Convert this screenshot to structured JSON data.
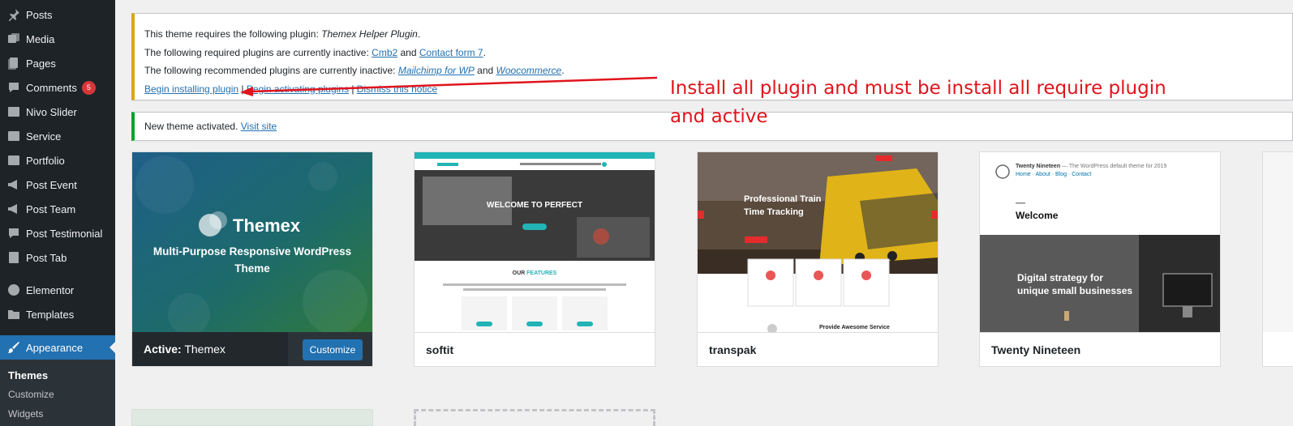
{
  "sidebar": {
    "items": [
      {
        "label": "Posts",
        "icon": "pin-icon"
      },
      {
        "label": "Media",
        "icon": "media-icon"
      },
      {
        "label": "Pages",
        "icon": "pages-icon"
      },
      {
        "label": "Comments",
        "icon": "comments-icon",
        "badge": "5"
      },
      {
        "label": "Nivo Slider",
        "icon": "slider-icon"
      },
      {
        "label": "Service",
        "icon": "service-icon"
      },
      {
        "label": "Portfolio",
        "icon": "portfolio-icon"
      },
      {
        "label": "Post Event",
        "icon": "megaphone-icon"
      },
      {
        "label": "Post Team",
        "icon": "megaphone-icon"
      },
      {
        "label": "Post Testimonial",
        "icon": "testimonial-icon"
      },
      {
        "label": "Post Tab",
        "icon": "tab-icon"
      },
      {
        "label": "Elementor",
        "icon": "elementor-icon"
      },
      {
        "label": "Templates",
        "icon": "folder-icon"
      },
      {
        "label": "Appearance",
        "icon": "brush-icon",
        "current": true
      }
    ],
    "submenu": [
      {
        "label": "Themes",
        "current": true
      },
      {
        "label": "Customize"
      },
      {
        "label": "Widgets"
      }
    ]
  },
  "notice_warning": {
    "line1_prefix": "This theme requires the following plugin: ",
    "line1_plugin": "Themex Helper Plugin",
    "line1_suffix": ".",
    "line2_prefix": "The following required plugins are currently inactive: ",
    "line2_link1": "Cmb2",
    "line2_and": " and ",
    "line2_link2": "Contact form 7",
    "line2_suffix": ".",
    "line3_prefix": "The following recommended plugins are currently inactive: ",
    "line3_link1": "Mailchimp for WP",
    "line3_and": " and ",
    "line3_link2": "Woocommerce",
    "line3_suffix": ".",
    "action1": "Begin installing plugin",
    "separator": " | ",
    "action2": "Begin activating plugins",
    "action3": "Dismiss this notice"
  },
  "notice_success": {
    "text": "New theme activated. ",
    "link": "Visit site"
  },
  "annotation": {
    "line1": "Install all plugin and must be install all require plugin",
    "line2": "and active"
  },
  "themes": {
    "active_prefix": "Active:",
    "active_name": " Themex",
    "customize": "Customize",
    "themex_logo": "Themex",
    "themex_tagline": "Multi-Purpose Responsive WordPress Theme",
    "softit_name": "softit",
    "softit_hero": "WELCOME TO PERFECT",
    "softit_features_a": "OUR ",
    "softit_features_b": "FEATURES",
    "transpak_name": "transpak",
    "transpak_hero1": "Professional Train",
    "transpak_hero2": "Time Tracking",
    "transpak_service": "Provide Awesome Service",
    "nineteen_name": "Twenty Nineteen",
    "nineteen_site": "Twenty Nineteen",
    "nineteen_desc": " — The WordPress default theme for 2019",
    "nineteen_nav": "Home · About · Blog · Contact",
    "nineteen_welcome": "Welcome",
    "nineteen_hero1": "Digital strategy for",
    "nineteen_hero2": "unique small businesses"
  },
  "colors": {
    "sidebar_bg": "#1d2327",
    "accent": "#2271b1",
    "warning": "#dba617",
    "success": "#00a32a",
    "annotation": "#e0141c",
    "badge": "#d63638"
  }
}
